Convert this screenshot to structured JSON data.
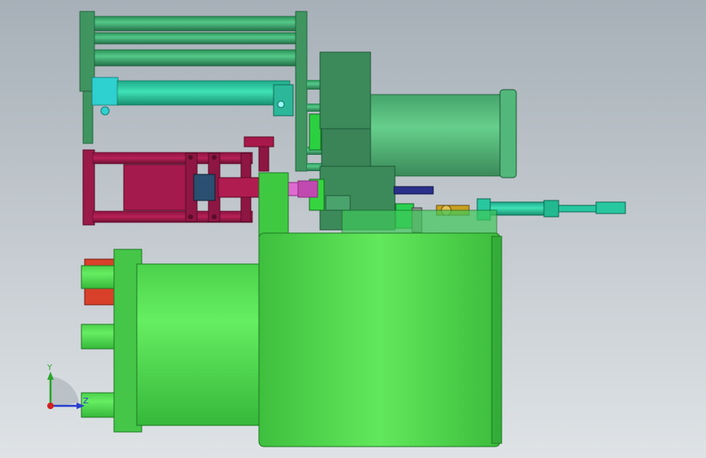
{
  "viewport": {
    "background_top": "#a7b0b8",
    "background_bottom": "#dfe3e6"
  },
  "colors": {
    "green_light": "#5fe85a",
    "green_mid": "#3fca3f",
    "green_dark": "#2a9a3a",
    "green_sage": "#3c8a5a",
    "green_sage_light": "#5bbf7e",
    "teal": "#27c7a0",
    "cyan": "#2fd0d0",
    "maroon": "#a01848",
    "maroon_dark": "#6e0f30",
    "magenta": "#e06bd0",
    "navy": "#2a2f8a",
    "orange_red": "#d8402a",
    "brass": "#c8a020"
  },
  "triad": {
    "y_label": "Y",
    "z_label": "Z",
    "y_color": "#2aa52a",
    "z_color": "#2a3fd0",
    "x_color": "#d02020"
  }
}
